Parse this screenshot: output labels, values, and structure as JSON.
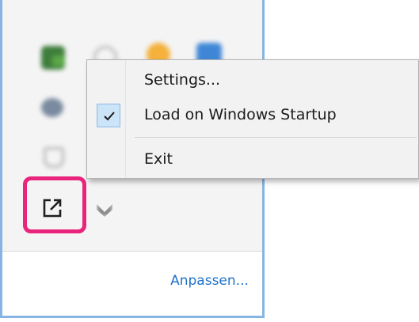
{
  "tray": {
    "customize_label": "Anpassen...",
    "border_color": "#86b5e3",
    "highlight_color": "#e8257a",
    "icons": [
      "app-icon",
      "clock-icon",
      "orange-app-icon",
      "blue-app-icon",
      "cloud-icon",
      "cup-icon",
      "open-external-icon",
      "chevron-down-icon"
    ]
  },
  "context_menu": {
    "items": [
      {
        "label": "Settings...",
        "checked": false
      },
      {
        "label": "Load on Windows Startup",
        "checked": true
      },
      {
        "label": "Exit",
        "checked": false
      }
    ]
  },
  "colors": {
    "link": "#1e72c9",
    "check_background": "#cce4f7"
  }
}
